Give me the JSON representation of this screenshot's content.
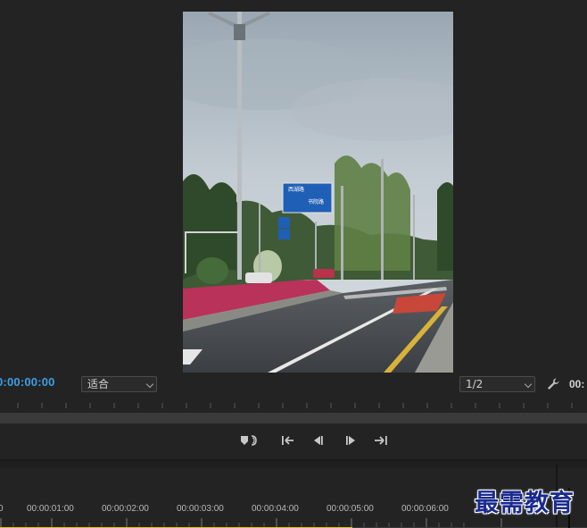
{
  "monitor": {
    "current_timecode": "0:00:00:00",
    "fit_select": "适合",
    "resolution_select": "1/2",
    "duration_partial": "00:",
    "settings_icon": "wrench-icon"
  },
  "preview": {
    "sign_text_1": "西湖路",
    "sign_text_2": "书院路"
  },
  "transport": {
    "controls": [
      {
        "name": "add-marker",
        "icon": "marker-icon"
      },
      {
        "name": "go-to-in",
        "icon": "go-to-in-icon"
      },
      {
        "name": "step-back",
        "icon": "step-back-icon"
      },
      {
        "name": "step-forward",
        "icon": "step-forward-icon"
      },
      {
        "name": "go-to-out",
        "icon": "go-to-out-icon"
      }
    ]
  },
  "timeline": {
    "ruler_labels": [
      "0",
      "00:00:01:00",
      "00:00:02:00",
      "00:00:03:00",
      "00:00:04:00",
      "00:00:05:00",
      "00:00:06:00"
    ],
    "playhead_progress": 0.6
  },
  "watermark": {
    "text": "最需教育"
  },
  "colors": {
    "timecode": "#3d9fe6",
    "playbar": "#e6c300",
    "panel": "#232323"
  }
}
